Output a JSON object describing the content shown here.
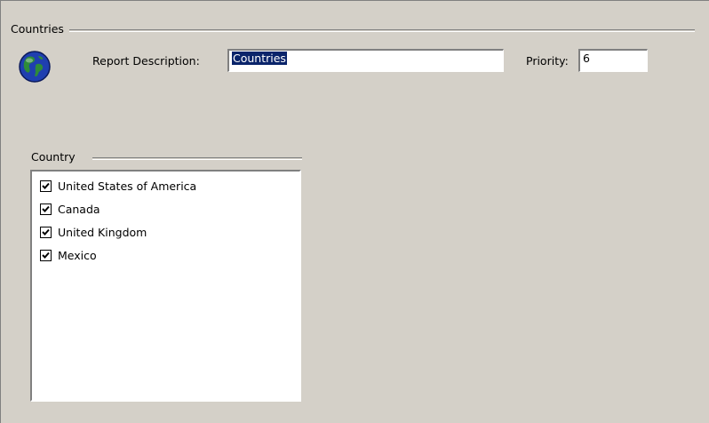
{
  "group": {
    "title": "Countries"
  },
  "form": {
    "report_description_label": "Report Description:",
    "report_description_value": "Countries",
    "priority_label": "Priority:",
    "priority_value": "6"
  },
  "country_group": {
    "title": "Country",
    "items": [
      {
        "label": "United States of America",
        "checked": true
      },
      {
        "label": "Canada",
        "checked": true
      },
      {
        "label": "United Kingdom",
        "checked": true
      },
      {
        "label": "Mexico",
        "checked": true
      }
    ]
  },
  "icons": {
    "globe": "globe-icon",
    "checkbox": "checkmark-icon"
  },
  "colors": {
    "background": "#d4d0c8",
    "selection": "#0a246a",
    "globe_ocean": "#1f3fb0",
    "globe_land": "#2e8b3a"
  }
}
